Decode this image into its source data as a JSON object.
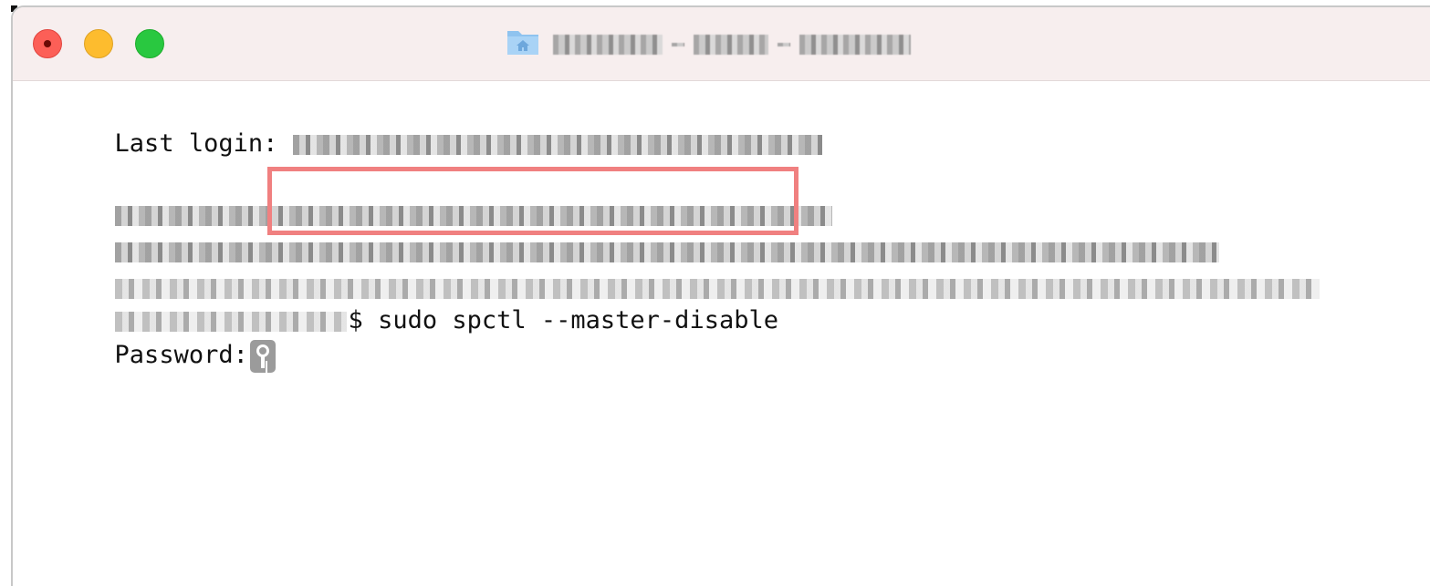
{
  "window": {
    "title_obscured": true
  },
  "terminal": {
    "last_login_label": "Last login:",
    "prompt_symbol": "$",
    "command": "sudo spctl --master-disable",
    "password_label": "Password:"
  },
  "icons": {
    "folder": "folder-home-icon",
    "key": "key-icon"
  },
  "colors": {
    "titlebar": "#f7eeee",
    "close": "#fc5f57",
    "minimize": "#fdbc2e",
    "maximize": "#29c840",
    "highlight": "#f08080"
  }
}
